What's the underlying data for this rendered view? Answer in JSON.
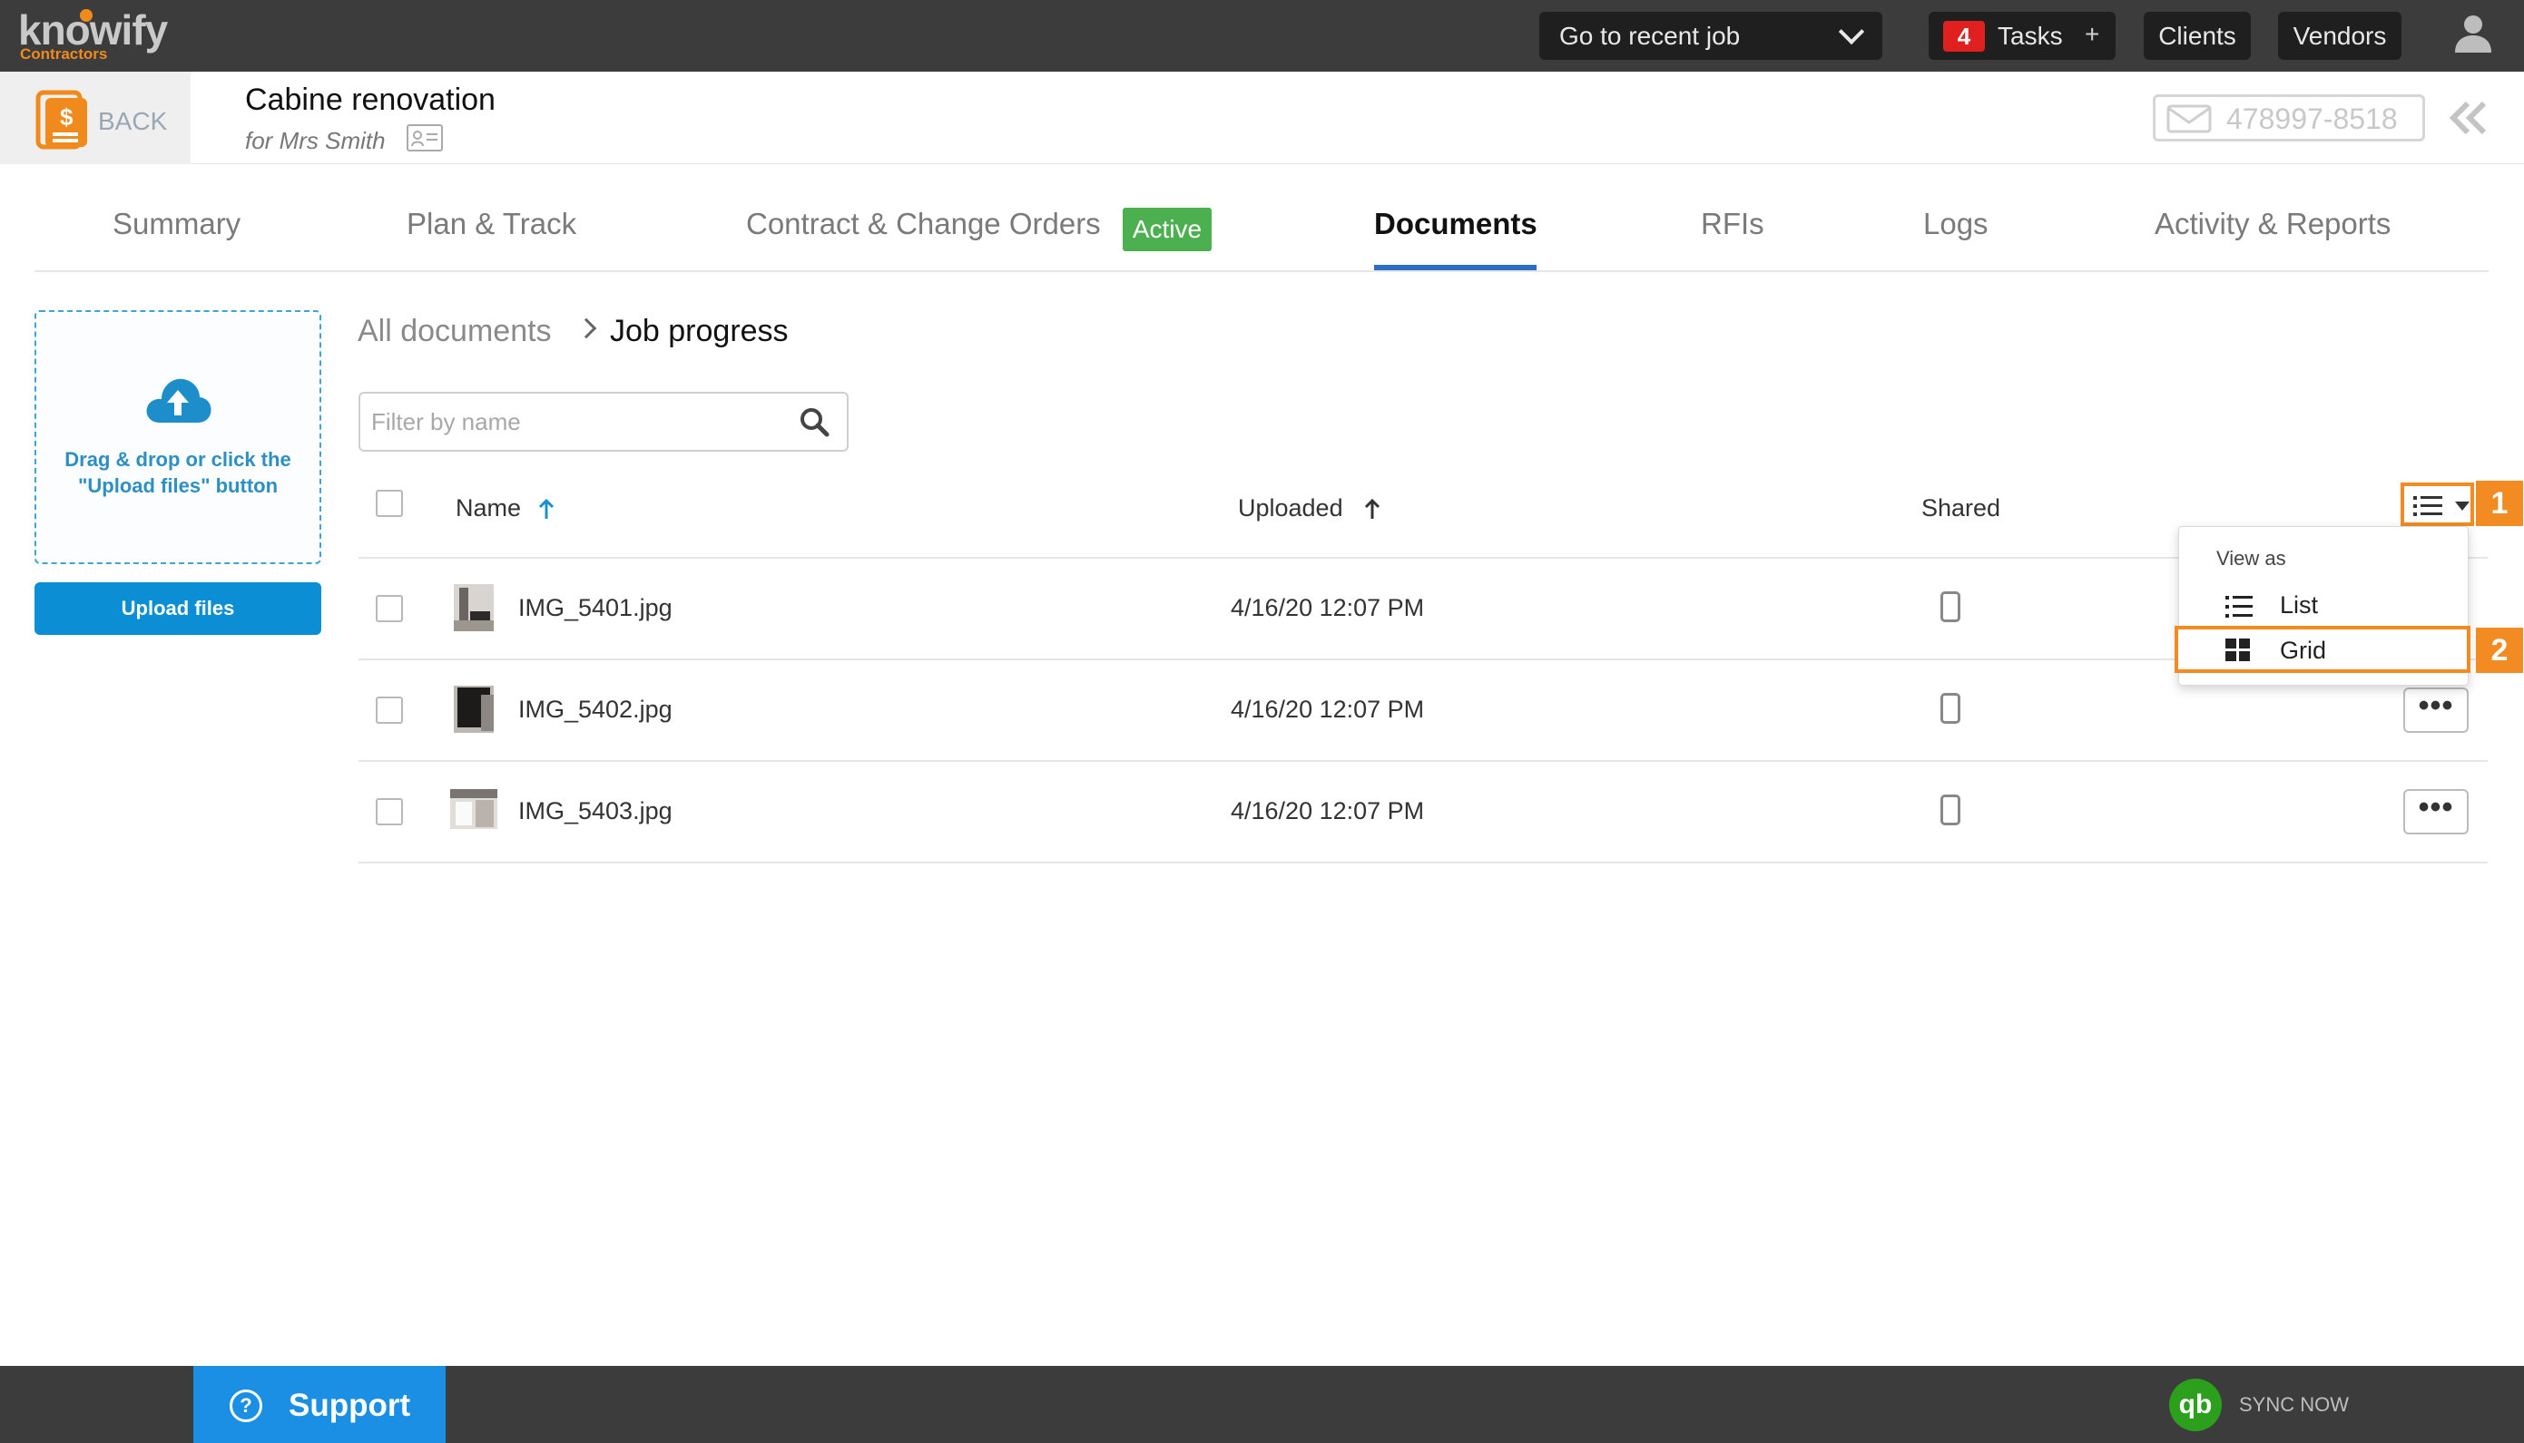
{
  "topbar": {
    "logo_text": "knowify",
    "logo_sub": "Contractors",
    "recent_job_label": "Go to recent job",
    "tasks_count": "4",
    "tasks_label": "Tasks",
    "tasks_plus": "+",
    "clients_label": "Clients",
    "vendors_label": "Vendors"
  },
  "job": {
    "back_label": "BACK",
    "title": "Cabine renovation",
    "subtitle": "for Mrs Smith",
    "phone": "478997-8518"
  },
  "tabs": [
    {
      "label": "Summary"
    },
    {
      "label": "Plan & Track"
    },
    {
      "label": "Contract & Change Orders"
    },
    {
      "label": "Documents"
    },
    {
      "label": "RFIs"
    },
    {
      "label": "Logs"
    },
    {
      "label": "Activity & Reports"
    }
  ],
  "contract_badge": "Active",
  "upload": {
    "drop_text": "Drag & drop or click the \"Upload files\" button",
    "button_label": "Upload files"
  },
  "breadcrumb": {
    "root": "All documents",
    "current": "Job progress"
  },
  "filter": {
    "placeholder": "Filter by name",
    "value": ""
  },
  "table": {
    "columns": {
      "name": "Name",
      "uploaded": "Uploaded",
      "shared": "Shared"
    },
    "rows": [
      {
        "name": "IMG_5401.jpg",
        "uploaded": "4/16/20 12:07 PM"
      },
      {
        "name": "IMG_5402.jpg",
        "uploaded": "4/16/20 12:07 PM"
      },
      {
        "name": "IMG_5403.jpg",
        "uploaded": "4/16/20 12:07 PM"
      }
    ],
    "more_label": "•••"
  },
  "view_menu": {
    "title": "View as",
    "items": [
      {
        "label": "List",
        "icon": "list-icon"
      },
      {
        "label": "Grid",
        "icon": "grid-icon"
      }
    ]
  },
  "annotations": {
    "marker1": "1",
    "marker2": "2"
  },
  "footer": {
    "support_label": "Support",
    "support_icon": "?",
    "qb_logo": "qb",
    "sync_label": "SYNC NOW"
  },
  "colors": {
    "topbar_bg": "#3c3c3c",
    "accent_blue": "#2a6fc4",
    "upload_blue": "#0b8ed4",
    "active_green": "#4caf50",
    "annotation_orange": "#f28b22",
    "support_blue": "#1b8fe3",
    "qb_green": "#2ca01c"
  }
}
